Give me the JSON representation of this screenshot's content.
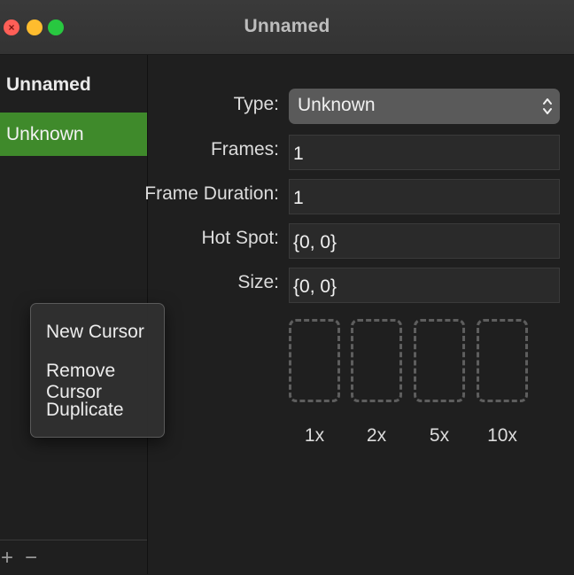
{
  "window": {
    "title": "Unnamed",
    "close_glyph": "×"
  },
  "sidebar": {
    "header": "Unnamed",
    "items": [
      {
        "label": "Unknown",
        "selected": true
      }
    ],
    "footer": {
      "add_label": "+",
      "remove_label": "−"
    }
  },
  "context_menu": {
    "items": [
      {
        "label": "New Cursor"
      },
      {
        "label": "Remove Cursor"
      },
      {
        "label": "Duplicate"
      }
    ]
  },
  "form": {
    "type": {
      "label": "Type:",
      "value": "Unknown"
    },
    "frames": {
      "label": "Frames:",
      "value": "1"
    },
    "frame_duration": {
      "label": "Frame Duration:",
      "value": "1"
    },
    "hot_spot": {
      "label": "Hot Spot:",
      "value": "{0, 0}"
    },
    "size": {
      "label": "Size:",
      "value": "{0, 0}"
    }
  },
  "previews": [
    {
      "label": "1x"
    },
    {
      "label": "2x"
    },
    {
      "label": "5x"
    },
    {
      "label": "10x"
    }
  ],
  "colors": {
    "selection": "#3f8a2b",
    "close_button": "#ff5f57",
    "minimize_button": "#febc2e",
    "zoom_button": "#28c840"
  },
  "icons": {
    "traffic_close": "close-icon",
    "traffic_minimize": "minimize-icon",
    "traffic_zoom": "zoom-icon",
    "select_arrows": "chevron-up-down-icon",
    "add": "plus-icon",
    "remove": "minus-icon"
  }
}
